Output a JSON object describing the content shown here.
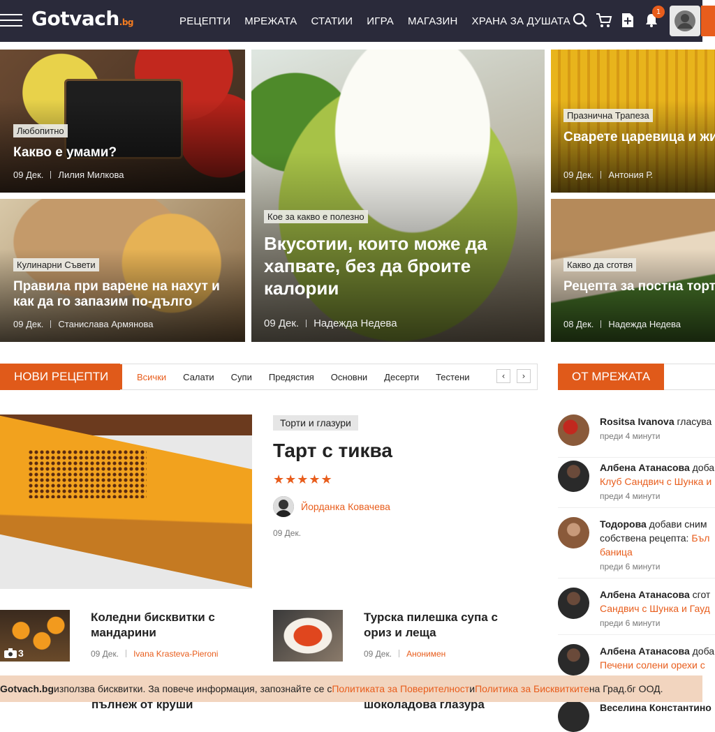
{
  "brand": {
    "logo_text": "Gotvach",
    "logo_suffix": ".bg",
    "accent": "#e85d1c"
  },
  "nav": [
    "РЕЦЕПТИ",
    "МРЕЖАТА",
    "СТАТИИ",
    "ИГРА",
    "МАГАЗИН",
    "ХРАНА ЗА ДУШАТА"
  ],
  "header_icons": [
    "search-icon",
    "cart-icon",
    "add-document-icon",
    "bell-icon",
    "user-avatar-icon"
  ],
  "notifications_count": "1",
  "features": [
    {
      "category": "Любопитно",
      "title": "Какво е умами?",
      "date": "09 Дек.",
      "author": "Лилия Милкова"
    },
    {
      "category": "Кое за какво е полезно",
      "title": "Вкусотии, които може да хапвате, без да броите калории",
      "date": "09 Дек.",
      "author": "Надежда Недева"
    },
    {
      "category": "Празнична Трапеза",
      "title": "Сварете царевица и жи здраве на Света Анна",
      "date": "09 Дек.",
      "author": "Антония Р."
    },
    {
      "category": "Кулинарни Съвети",
      "title": "Правила при варене на нахут и как да го запазим по-дълго",
      "date": "09 Дек.",
      "author": "Станислава Армянова"
    },
    {
      "category": "Какво да сготвя",
      "title": "Рецепта за постна торт ще впечатлите всички",
      "date": "08 Дек.",
      "author": "Надежда Недева"
    }
  ],
  "new_recipes": {
    "heading": "НОВИ РЕЦЕПТИ",
    "tabs": [
      "Всички",
      "Салати",
      "Супи",
      "Предястия",
      "Основни",
      "Десерти",
      "Тестени"
    ],
    "prev": "‹",
    "next": "›",
    "featured": {
      "category": "Торти и глазури",
      "title": "Тарт с тиква",
      "stars": "★★★★★",
      "rating": 5,
      "author": "Йорданка Ковачева",
      "date": "09 Дек."
    },
    "items": [
      {
        "title": "Коледни бисквитки с мандарини",
        "date": "09 Дек.",
        "author": "Ivana Krasteva-Pieroni",
        "photos": "3"
      },
      {
        "title": "Турска пилешка супа с ориз и леща",
        "date": "09 Дек.",
        "author": "Анонимен"
      }
    ],
    "peek_titles": [
      "пълнеж от круши",
      "шоколадова глазура"
    ]
  },
  "network": {
    "heading": "ОТ МРЕЖАТА",
    "feed": [
      {
        "user": "Rositsa Ivanova",
        "action": " гласува",
        "link": "",
        "time": "преди 4 минути"
      },
      {
        "user": "Албена Атанасова",
        "action": " доба",
        "link": "Клуб Сандвич с Шунка и",
        "time": "преди 4 минути"
      },
      {
        "user": "Тодорова",
        "action": " добави сним",
        "line2": "собствена рецепта: ",
        "link": "Бъл",
        "link2": "баница",
        "time": "преди 6 минути"
      },
      {
        "user": "Албена Атанасова",
        "action": " сгот",
        "link": "Сандвич с Шунка и Гауд",
        "time": "преди 6 минути"
      },
      {
        "user": "Албена Атанасова",
        "action": " доба",
        "link": "Печени солени орехи с",
        "time": ""
      },
      {
        "user": "Веселина Константино",
        "action": "",
        "link": "",
        "time": ""
      }
    ]
  },
  "cookie": {
    "site": "Gotvach.bg",
    "text1": " използва бисквитки. За повече информация, запознайте се с ",
    "link1": "Политиката за Поверителност",
    "text2": " и ",
    "link2": "Политика за Бисквитките",
    "text3": " на Град.бг ООД."
  }
}
